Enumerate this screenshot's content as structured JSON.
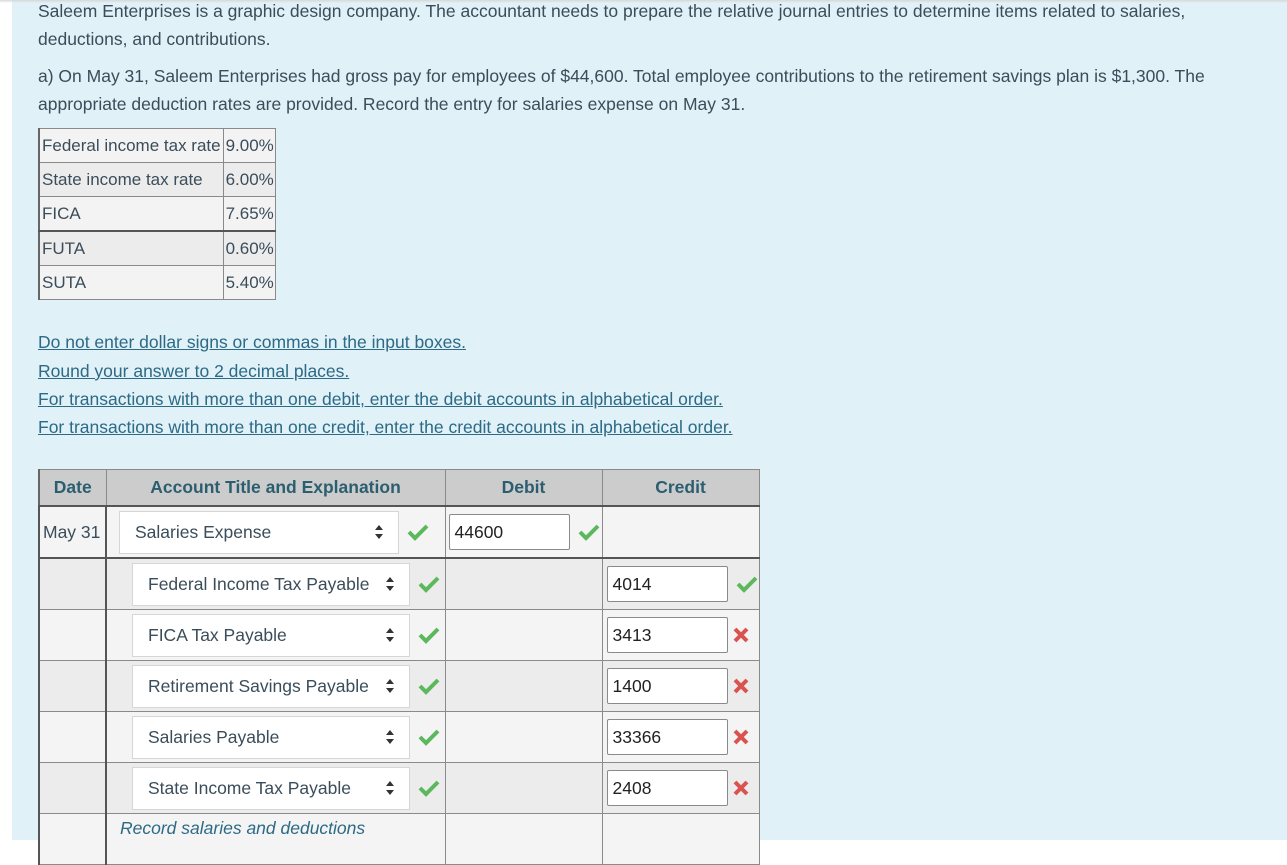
{
  "question": {
    "intro": "Saleem Enterprises is a graphic design company. The accountant needs to prepare the relative journal entries to determine items related to salaries, deductions, and contributions.",
    "part_a": "a) On May 31, Saleem Enterprises had gross pay for employees of $44,600. Total employee contributions to the retirement savings plan is $1,300. The appropriate deduction rates are provided. Record the entry for salaries expense on May 31."
  },
  "rates_table": [
    {
      "label": "Federal income tax rate",
      "value": "9.00%"
    },
    {
      "label": "State income tax rate",
      "value": "6.00%"
    },
    {
      "label": "FICA",
      "value": "7.65%"
    },
    {
      "label": "FUTA",
      "value": "0.60%"
    },
    {
      "label": "SUTA",
      "value": "5.40%"
    }
  ],
  "instructions": [
    "Do not enter dollar signs or commas in the input boxes.",
    "Round your answer to 2 decimal places.",
    "For transactions with more than one debit, enter the debit accounts in alphabetical order.",
    "For transactions with more than one credit, enter the credit accounts in alphabetical order."
  ],
  "journal": {
    "headers": {
      "date": "Date",
      "account": "Account Title and Explanation",
      "debit": "Debit",
      "credit": "Credit"
    },
    "debit_row": {
      "date": "May 31",
      "account": "Salaries Expense",
      "account_status": "correct",
      "debit": "44600",
      "debit_status": "correct"
    },
    "credit_rows": [
      {
        "account": "Federal Income Tax Payable",
        "account_status": "correct",
        "credit": "4014",
        "credit_status": "correct"
      },
      {
        "account": "FICA Tax Payable",
        "account_status": "correct",
        "credit": "3413",
        "credit_status": "incorrect"
      },
      {
        "account": "Retirement Savings Payable",
        "account_status": "correct",
        "credit": "1400",
        "credit_status": "incorrect"
      },
      {
        "account": "Salaries Payable",
        "account_status": "correct",
        "credit": "33366",
        "credit_status": "incorrect"
      },
      {
        "account": "State Income Tax Payable",
        "account_status": "correct",
        "credit": "2408",
        "credit_status": "incorrect"
      }
    ],
    "explanation": "Record salaries and deductions"
  },
  "colors": {
    "panel_bg": "#e0f1f8",
    "text": "#3b4d5a",
    "link": "#2c6a85",
    "header_text": "#2c5e70",
    "correct": "#5cb85c",
    "incorrect": "#d9534f"
  }
}
